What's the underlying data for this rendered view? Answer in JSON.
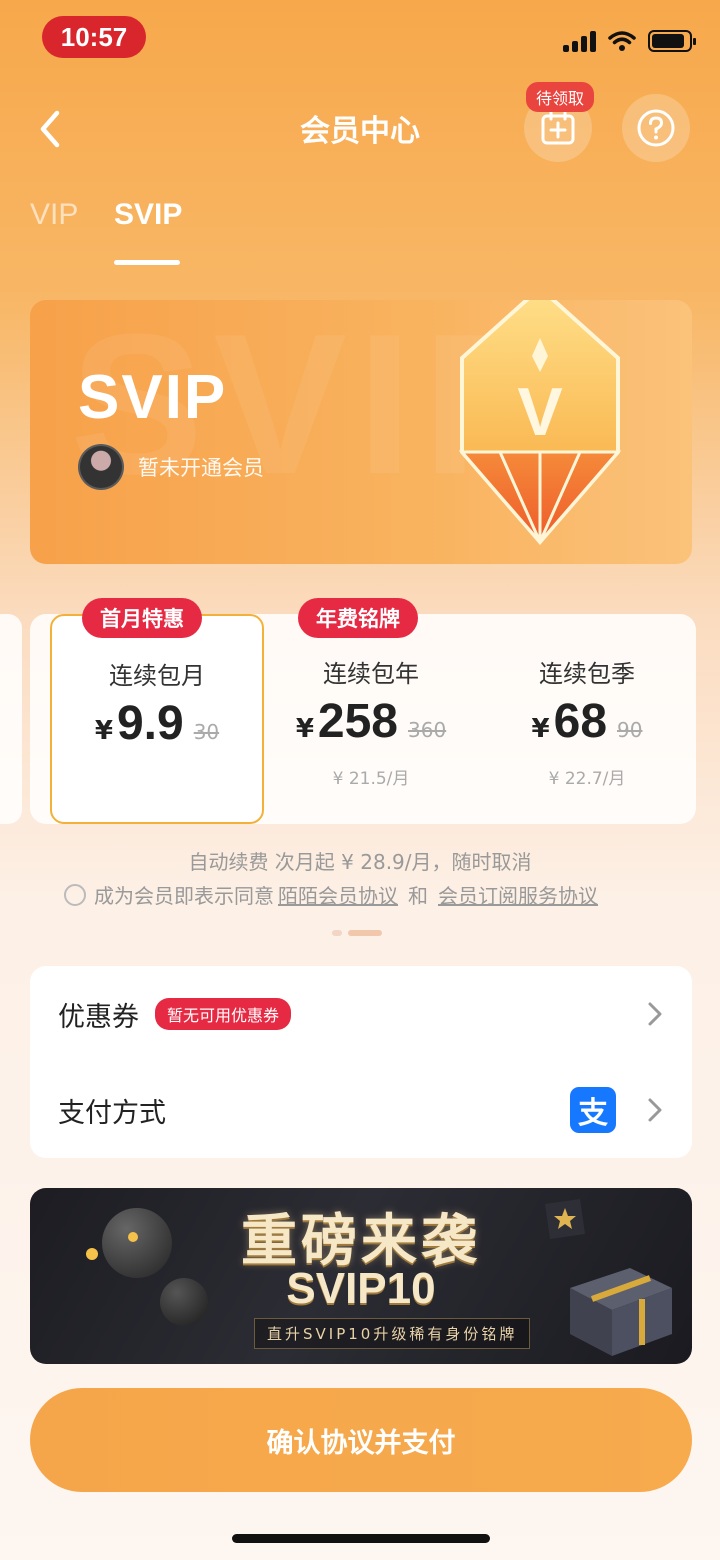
{
  "status": {
    "time": "10:57",
    "battery_level": 0.9
  },
  "header": {
    "title": "会员中心",
    "pending_badge": "待领取"
  },
  "tabs": [
    {
      "label": "VIP",
      "active": false
    },
    {
      "label": "SVIP",
      "active": true
    }
  ],
  "card": {
    "logo": "SVIP",
    "member_status": "暂未开通会员",
    "gem_letter": "V"
  },
  "plans": [
    {
      "badge": "首月特惠",
      "name": "连续包月",
      "currency": "¥",
      "price": "9.9",
      "original": "30",
      "sub": "",
      "selected": true
    },
    {
      "badge": "年费铭牌",
      "name": "连续包年",
      "currency": "¥",
      "price": "258",
      "original": "360",
      "sub": "¥ 21.5/月",
      "selected": false
    },
    {
      "badge": "",
      "name": "连续包季",
      "currency": "¥",
      "price": "68",
      "original": "90",
      "sub": "¥ 22.7/月",
      "selected": false
    }
  ],
  "renew_note": "自动续费 次月起 ¥ 28.9/月，随时取消",
  "agreement": {
    "prefix": "成为会员即表示同意",
    "link1": "陌陌会员协议",
    "and": "和",
    "link2": "会员订阅服务协议"
  },
  "options": {
    "coupon_label": "优惠券",
    "coupon_badge": "暂无可用优惠券",
    "payment_label": "支付方式",
    "payment_icon_char": "支"
  },
  "banner": {
    "title": "重磅来袭",
    "subtitle": "SVIP10",
    "note": "直升SVIP10升级稀有身份铭牌"
  },
  "pay_button": "确认协议并支付",
  "colors": {
    "accent": "#f7a84b",
    "badge_red": "#e62a44",
    "selected_border": "#f3b13a",
    "alipay_blue": "#1677ff"
  }
}
